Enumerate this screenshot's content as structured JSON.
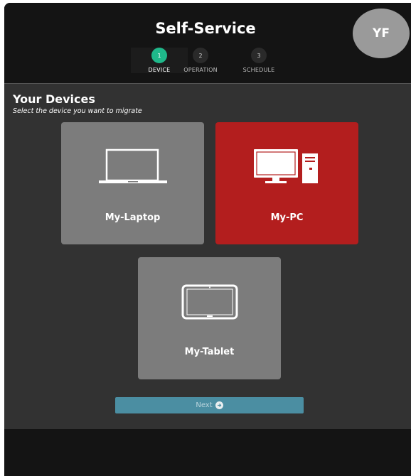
{
  "header": {
    "title": "Self-Service",
    "avatar_initials": "YF"
  },
  "steps": [
    {
      "number": "1",
      "label": "DEVICE",
      "active": true
    },
    {
      "number": "2",
      "label": "OPERATION",
      "active": false
    },
    {
      "number": "3",
      "label": "SCHEDULE",
      "active": false
    }
  ],
  "devices_section": {
    "title": "Your Devices",
    "subtitle": "Select the device you want to migrate"
  },
  "devices": [
    {
      "label": "My-Laptop",
      "icon": "laptop-icon",
      "selected": false
    },
    {
      "label": "My-PC",
      "icon": "desktop-pc-icon",
      "selected": true
    },
    {
      "label": "My-Tablet",
      "icon": "tablet-icon",
      "selected": false
    }
  ],
  "actions": {
    "next_label": "Next"
  },
  "colors": {
    "accent_step": "#1fb88a",
    "selected_tile": "#b31e1e",
    "tile": "#7c7c7c",
    "next_button": "#4b8ea2",
    "panel": "#323232",
    "chrome": "#141414"
  }
}
